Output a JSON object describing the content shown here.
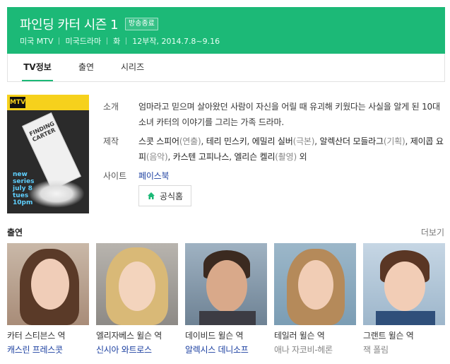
{
  "header": {
    "title": "파인딩 카터 시즌 1",
    "badge": "방송종료",
    "meta": [
      "미국 MTV",
      "미국드라마",
      "화",
      "12부작, 2014.7.8~9.16"
    ]
  },
  "tabs": [
    {
      "label": "TV정보",
      "active": true
    },
    {
      "label": "출연",
      "active": false
    },
    {
      "label": "시리즈",
      "active": false
    }
  ],
  "poster": {
    "logo": "MTV",
    "carton_text": "FINDING CARTER",
    "promo_text": "new series july 8 tues 10pm"
  },
  "info": {
    "intro_label": "소개",
    "intro_text": "엄마라고 믿으며 살아왔던 사람이 자신을 어릴 때 유괴해 키웠다는 사실을 알게 된 10대 소녀 카터의 이야기를 그리는 가족 드라마.",
    "staff_label": "제작",
    "staff": [
      {
        "name": "스콧 스피어",
        "role": "(연출)"
      },
      {
        "name": "테리 민스키",
        "role": ""
      },
      {
        "name": "에밀리 실버",
        "role": "(극본)"
      },
      {
        "name": "알렉산더 모들라그",
        "role": "(기획)"
      },
      {
        "name": "제이콥 요피",
        "role": "(음악)"
      },
      {
        "name": "카스텐 고피나스",
        "role": ""
      },
      {
        "name": "엘리슨 켈리",
        "role": "(촬영)"
      }
    ],
    "staff_suffix": "외",
    "site_label": "사이트",
    "site_link": "페이스북",
    "homepage_button": "공식홈"
  },
  "cast_section": {
    "title": "출연",
    "more": "더보기",
    "members": [
      {
        "role": "카터 스티븐스 역",
        "actor": "캐스린 프레스콧",
        "linked": true
      },
      {
        "role": "엘리자베스 윌슨 역",
        "actor": "신시아 와트로스",
        "linked": true
      },
      {
        "role": "데이비드 윌슨 역",
        "actor": "알렉시스 데니소프",
        "linked": true
      },
      {
        "role": "테일러 윌슨 역",
        "actor": "애나 자코비-헤론",
        "linked": false
      },
      {
        "role": "그랜트 윌슨 역",
        "actor": "잭 폴림",
        "linked": false
      }
    ]
  },
  "colors": {
    "accent": "#1cb977",
    "link": "#1b3fa0"
  },
  "icons": {
    "home": "home-icon"
  }
}
